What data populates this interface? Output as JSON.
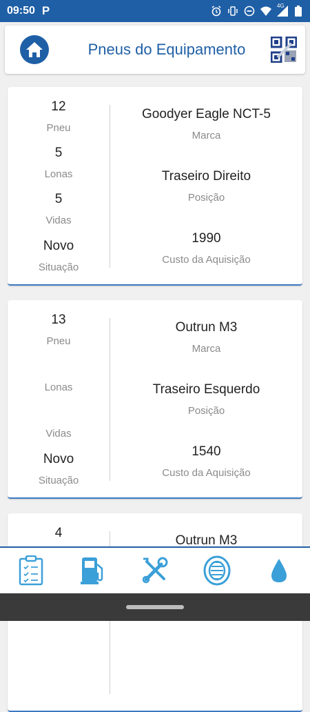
{
  "status_bar": {
    "time": "09:50",
    "app_indicator": "P",
    "icons": [
      "alarm-icon",
      "vibrate-icon",
      "dnd-icon",
      "wifi-icon",
      "signal-icon",
      "battery-icon"
    ],
    "network_label": "4G"
  },
  "header": {
    "title": "Pneus do Equipamento",
    "home_icon": "home-icon",
    "qr_icon": "qr-code-icon"
  },
  "labels": {
    "pneu": "Pneu",
    "lonas": "Lonas",
    "vidas": "Vidas",
    "situacao": "Situação",
    "marca": "Marca",
    "posicao": "Posição",
    "custo": "Custo da Aquisição"
  },
  "tires": [
    {
      "pneu": "12",
      "lonas": "5",
      "vidas": "5",
      "situacao": "Novo",
      "marca": "Goodyer Eagle NCT-5",
      "posicao": "Traseiro Direito",
      "custo": "1990"
    },
    {
      "pneu": "13",
      "lonas": "",
      "vidas": "",
      "situacao": "Novo",
      "marca": "Outrun M3",
      "posicao": "Traseiro Esquerdo",
      "custo": "1540"
    },
    {
      "pneu": "4",
      "marca": "Outrun M3"
    }
  ],
  "bottom_nav": [
    "clipboard-icon",
    "fuel-pump-icon",
    "tools-icon",
    "tire-icon",
    "water-drop-icon"
  ],
  "colors": {
    "primary": "#1f5fa6",
    "accent": "#3b9fd8"
  }
}
